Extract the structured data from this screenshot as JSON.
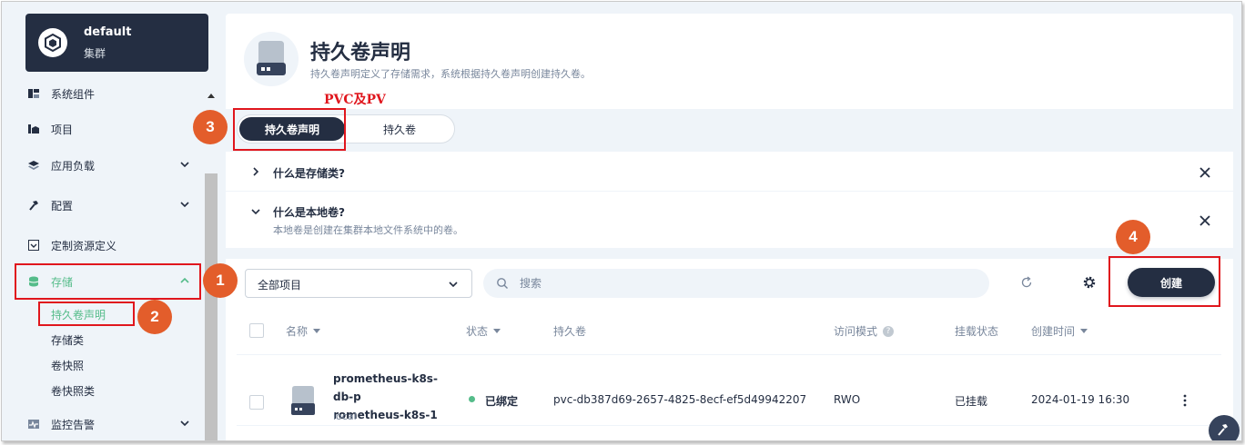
{
  "cluster": {
    "name": "default",
    "type": "集群"
  },
  "sidebar": {
    "items": [
      {
        "label": "系统组件",
        "icon": "components-icon"
      },
      {
        "label": "项目",
        "icon": "project-icon"
      },
      {
        "label": "应用负载",
        "icon": "layers-icon"
      },
      {
        "label": "配置",
        "icon": "hammer-icon"
      },
      {
        "label": "定制资源定义",
        "icon": "crd-icon"
      },
      {
        "label": "存储",
        "icon": "database-icon"
      },
      {
        "label": "监控告警",
        "icon": "monitor-icon"
      }
    ],
    "storage_sub": [
      "持久卷声明",
      "存储类",
      "卷快照",
      "卷快照类"
    ]
  },
  "page": {
    "title": "持久卷声明",
    "description": "持久卷声明定义了存储需求，系统根据持久卷声明创建持久卷。"
  },
  "annotation": {
    "label": "PVC及PV",
    "badges": [
      "1",
      "2",
      "3",
      "4"
    ]
  },
  "tabs": [
    "持久卷声明",
    "持久卷"
  ],
  "faq": [
    {
      "title": "什么是存储类?",
      "sub": ""
    },
    {
      "title": "什么是本地卷?",
      "sub": "本地卷是创建在集群本地文件系统中的卷。"
    }
  ],
  "toolbar": {
    "project_select": "全部项目",
    "search_placeholder": "搜索",
    "create_label": "创建"
  },
  "table": {
    "headers": [
      "名称",
      "状态",
      "持久卷",
      "访问模式",
      "挂载状态",
      "创建时间"
    ],
    "help_glyph": "?",
    "rows": [
      {
        "name_line1": "prometheus-k8s-db-p",
        "name_line2": "rometheus-k8s-1",
        "storage_class": "local",
        "status": "已绑定",
        "volume": "pvc-db387d69-2657-4825-8ecf-ef5d49942207",
        "access_mode": "RWO",
        "mount_status": "已挂载",
        "created": "2024-01-19 16:30"
      }
    ]
  },
  "colors": {
    "accent_green": "#55bc8a",
    "dark_navy": "#242e42",
    "annotation_red": "#e0161d",
    "badge_orange": "#e35d2b"
  }
}
